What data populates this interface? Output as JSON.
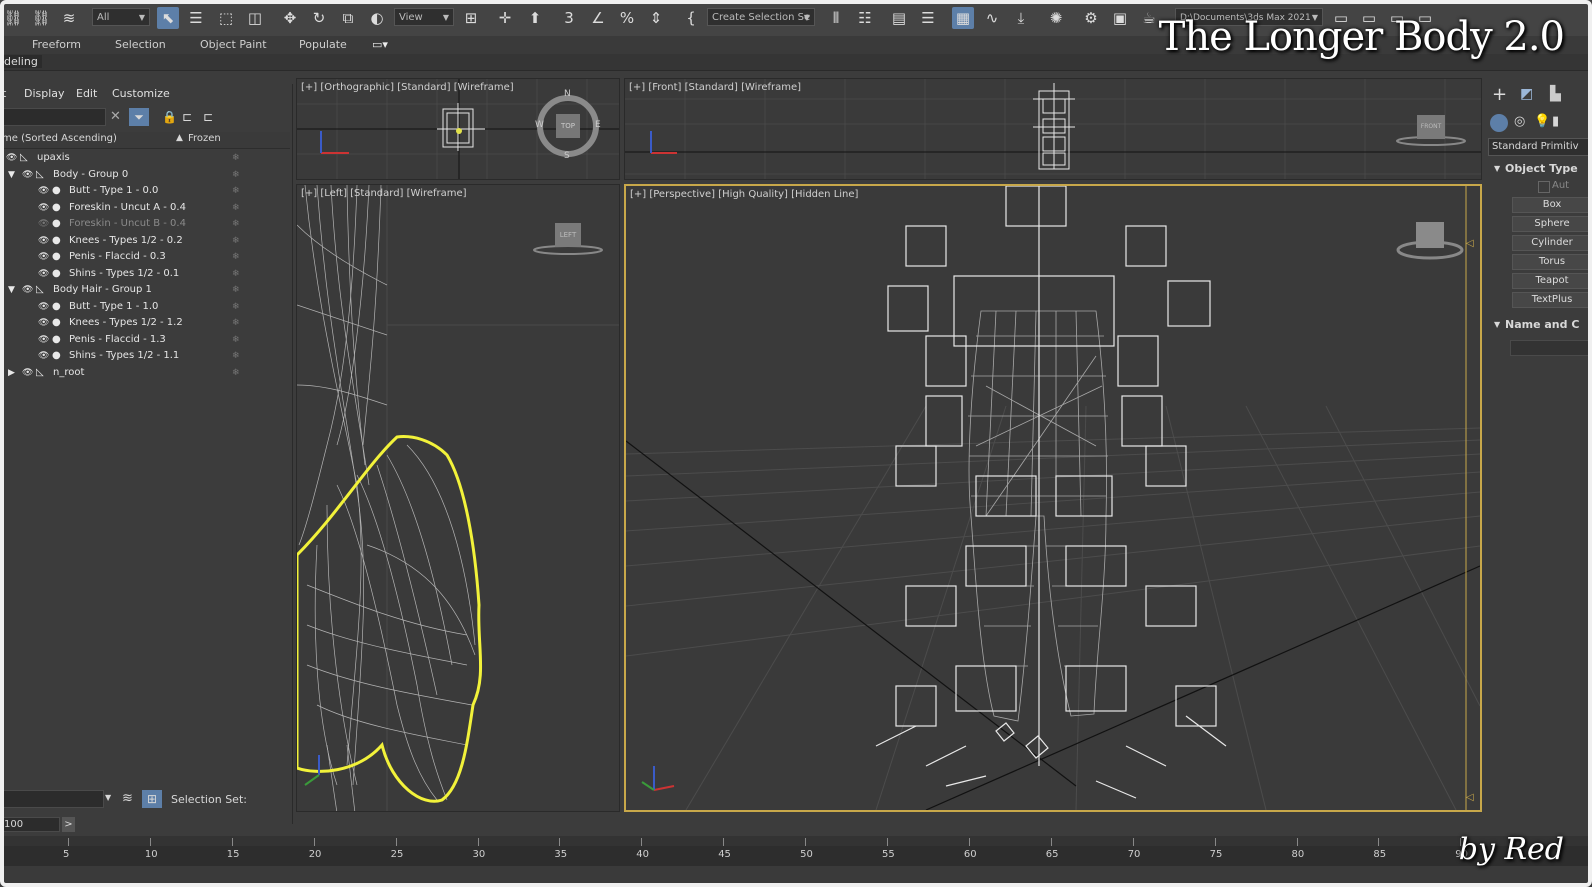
{
  "toolbar": {
    "filter_value": "All",
    "view_value": "View",
    "selection_set_value": "Create Selection Se",
    "path_value": "D:\\Documents\\3ds Max 2021",
    "icons": [
      "link-icon",
      "unlink-icon",
      "bind-space-warp-icon",
      "select-object-icon",
      "select-by-name-icon",
      "rect-selection-icon",
      "window-crossing-icon",
      "move-icon",
      "rotate-icon",
      "scale-icon",
      "placement-icon",
      "select-manipulate-icon",
      "snaps-toggle-icon",
      "angle-snap-icon",
      "percent-snap-icon",
      "spinner-snap-icon",
      "edit-named-selection-icon",
      "mirror-icon",
      "align-icon",
      "scene-explorer-icon",
      "layer-explorer-icon",
      "toggle-ribbon-icon",
      "curve-editor-icon",
      "schematic-view-icon",
      "material-editor-icon",
      "render-setup-icon",
      "render-frame-icon",
      "render-icon"
    ]
  },
  "ribbon": {
    "tabs": [
      "Freeform",
      "Selection",
      "Object Paint",
      "Populate"
    ],
    "sub_label": "deling"
  },
  "explorer": {
    "menu": [
      "t",
      "Display",
      "Edit",
      "Customize"
    ],
    "header_name": "me (Sorted Ascending)",
    "header_frozen": "Frozen",
    "rows": [
      {
        "label": "upaxis",
        "level": 0,
        "expand": ""
      },
      {
        "label": "Body - Group 0",
        "level": 1,
        "expand": "▼"
      },
      {
        "label": "Butt - Type 1 - 0.0",
        "level": 2,
        "expand": ""
      },
      {
        "label": "Foreskin - Uncut A - 0.4",
        "level": 2,
        "expand": ""
      },
      {
        "label": "Foreskin - Uncut B - 0.4",
        "level": 2,
        "expand": "",
        "dim": true
      },
      {
        "label": "Knees - Types 1/2 - 0.2",
        "level": 2,
        "expand": ""
      },
      {
        "label": "Penis - Flaccid - 0.3",
        "level": 2,
        "expand": ""
      },
      {
        "label": "Shins - Types 1/2 - 0.1",
        "level": 2,
        "expand": ""
      },
      {
        "label": "Body Hair - Group 1",
        "level": 1,
        "expand": "▼"
      },
      {
        "label": "Butt - Type 1 - 1.0",
        "level": 2,
        "expand": ""
      },
      {
        "label": "Knees - Types 1/2 - 1.2",
        "level": 2,
        "expand": ""
      },
      {
        "label": "Penis - Flaccid - 1.3",
        "level": 2,
        "expand": ""
      },
      {
        "label": "Shins - Types 1/2 - 1.1",
        "level": 2,
        "expand": ""
      },
      {
        "label": "n_root",
        "level": 1,
        "expand": "▶"
      }
    ],
    "selection_set_label": "Selection Set:",
    "frame_value": "100",
    "frame_arrow": ">"
  },
  "viewports": {
    "top_left": "[+] [Orthographic] [Standard] [Wireframe]",
    "top_right": "[+] [Front] [Standard] [Wireframe]",
    "bottom_left": "[+] [Left] [Standard] [Wireframe]",
    "bottom_right": "[+] [Perspective] [High Quality] [Hidden Line]",
    "compass": {
      "n": "N",
      "s": "S",
      "w": "W",
      "e": "E",
      "cube": "TOP"
    },
    "front_cube": "FRONT",
    "left_cube": "LEFT"
  },
  "command_panel": {
    "dropdown": "Standard Primitiv",
    "object_type": "Object Type",
    "autogrid": "Aut",
    "buttons": [
      "Box",
      "Sphere",
      "Cylinder",
      "Torus",
      "Teapot",
      "TextPlus"
    ],
    "name_and_color": "Name and C"
  },
  "timeline": {
    "ticks": [
      "5",
      "10",
      "15",
      "20",
      "25",
      "30",
      "35",
      "40",
      "45",
      "50",
      "55",
      "60",
      "65",
      "70",
      "75",
      "80",
      "85",
      "90"
    ]
  },
  "overlay": {
    "title": "The Longer Body 2.0",
    "byline": "by Red"
  },
  "colors": {
    "active_viewport_border": "#c8a84a",
    "selection_outline": "#f2f23a",
    "wire": "#bdbdbd"
  }
}
